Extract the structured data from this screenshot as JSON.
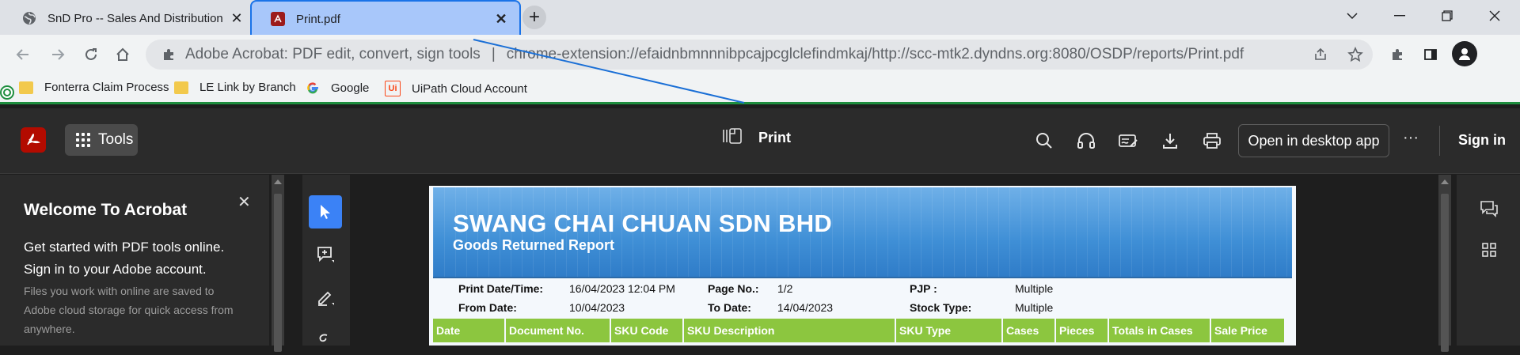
{
  "browser": {
    "tabs": [
      {
        "title": "SnD Pro -- Sales And Distribution",
        "icon": "globe-icon",
        "active": false
      },
      {
        "title": "Print.pdf",
        "icon": "acrobat-icon",
        "active": true
      }
    ],
    "omnibox": {
      "site": "Adobe Acrobat: PDF edit, convert, sign tools",
      "separator": "|",
      "url": "chrome-extension://efaidnbmnnnibpcajpcglclefindmkaj/http://scc-mtk2.dyndns.org:8080/OSDP/reports/Print.pdf"
    },
    "bookmarks": [
      {
        "label": "Fonterra Claim Process",
        "icon": "folder-icon"
      },
      {
        "label": "LE Link by Branch",
        "icon": "folder-icon"
      },
      {
        "label": "Google",
        "icon": "google-icon"
      },
      {
        "label": "UiPath Cloud Account",
        "icon": "uipath-icon"
      }
    ],
    "colors": {
      "active_tab": "#a8c7fa",
      "accent": "#1a73e8",
      "bookmark_bar_border": "#1e8e3e"
    }
  },
  "acrobat": {
    "tools_label": "Tools",
    "doc_title": "Print",
    "open_desktop_label": "Open in desktop app",
    "more_label": "···",
    "signin_label": "Sign in",
    "welcome": {
      "title": "Welcome To Acrobat",
      "line1": "Get started with PDF tools online. Sign in to your Adobe account.",
      "line2": "Files you work with online are saved to Adobe cloud storage for quick access from anywhere."
    }
  },
  "report": {
    "company": "SWANG CHAI CHUAN SDN BHD",
    "title": "Goods Returned Report",
    "meta": {
      "print_label": "Print Date/Time:",
      "print_value": "16/04/2023 12:04 PM",
      "page_label": "Page No.:",
      "page_value": "1/2",
      "pjp_label": "PJP :",
      "pjp_value": "Multiple",
      "from_label": "From Date:",
      "from_value": "10/04/2023",
      "to_label": "To Date:",
      "to_value": "14/04/2023",
      "stock_label": "Stock Type:",
      "stock_value": "Multiple"
    },
    "columns": [
      "Date",
      "Document No.",
      "SKU Code",
      "SKU Description",
      "SKU Type",
      "Cases",
      "Pieces",
      "Totals in Cases",
      "Sale Price"
    ],
    "colors": {
      "banner": "#3f8fd6",
      "header": "#8cc63f"
    }
  }
}
